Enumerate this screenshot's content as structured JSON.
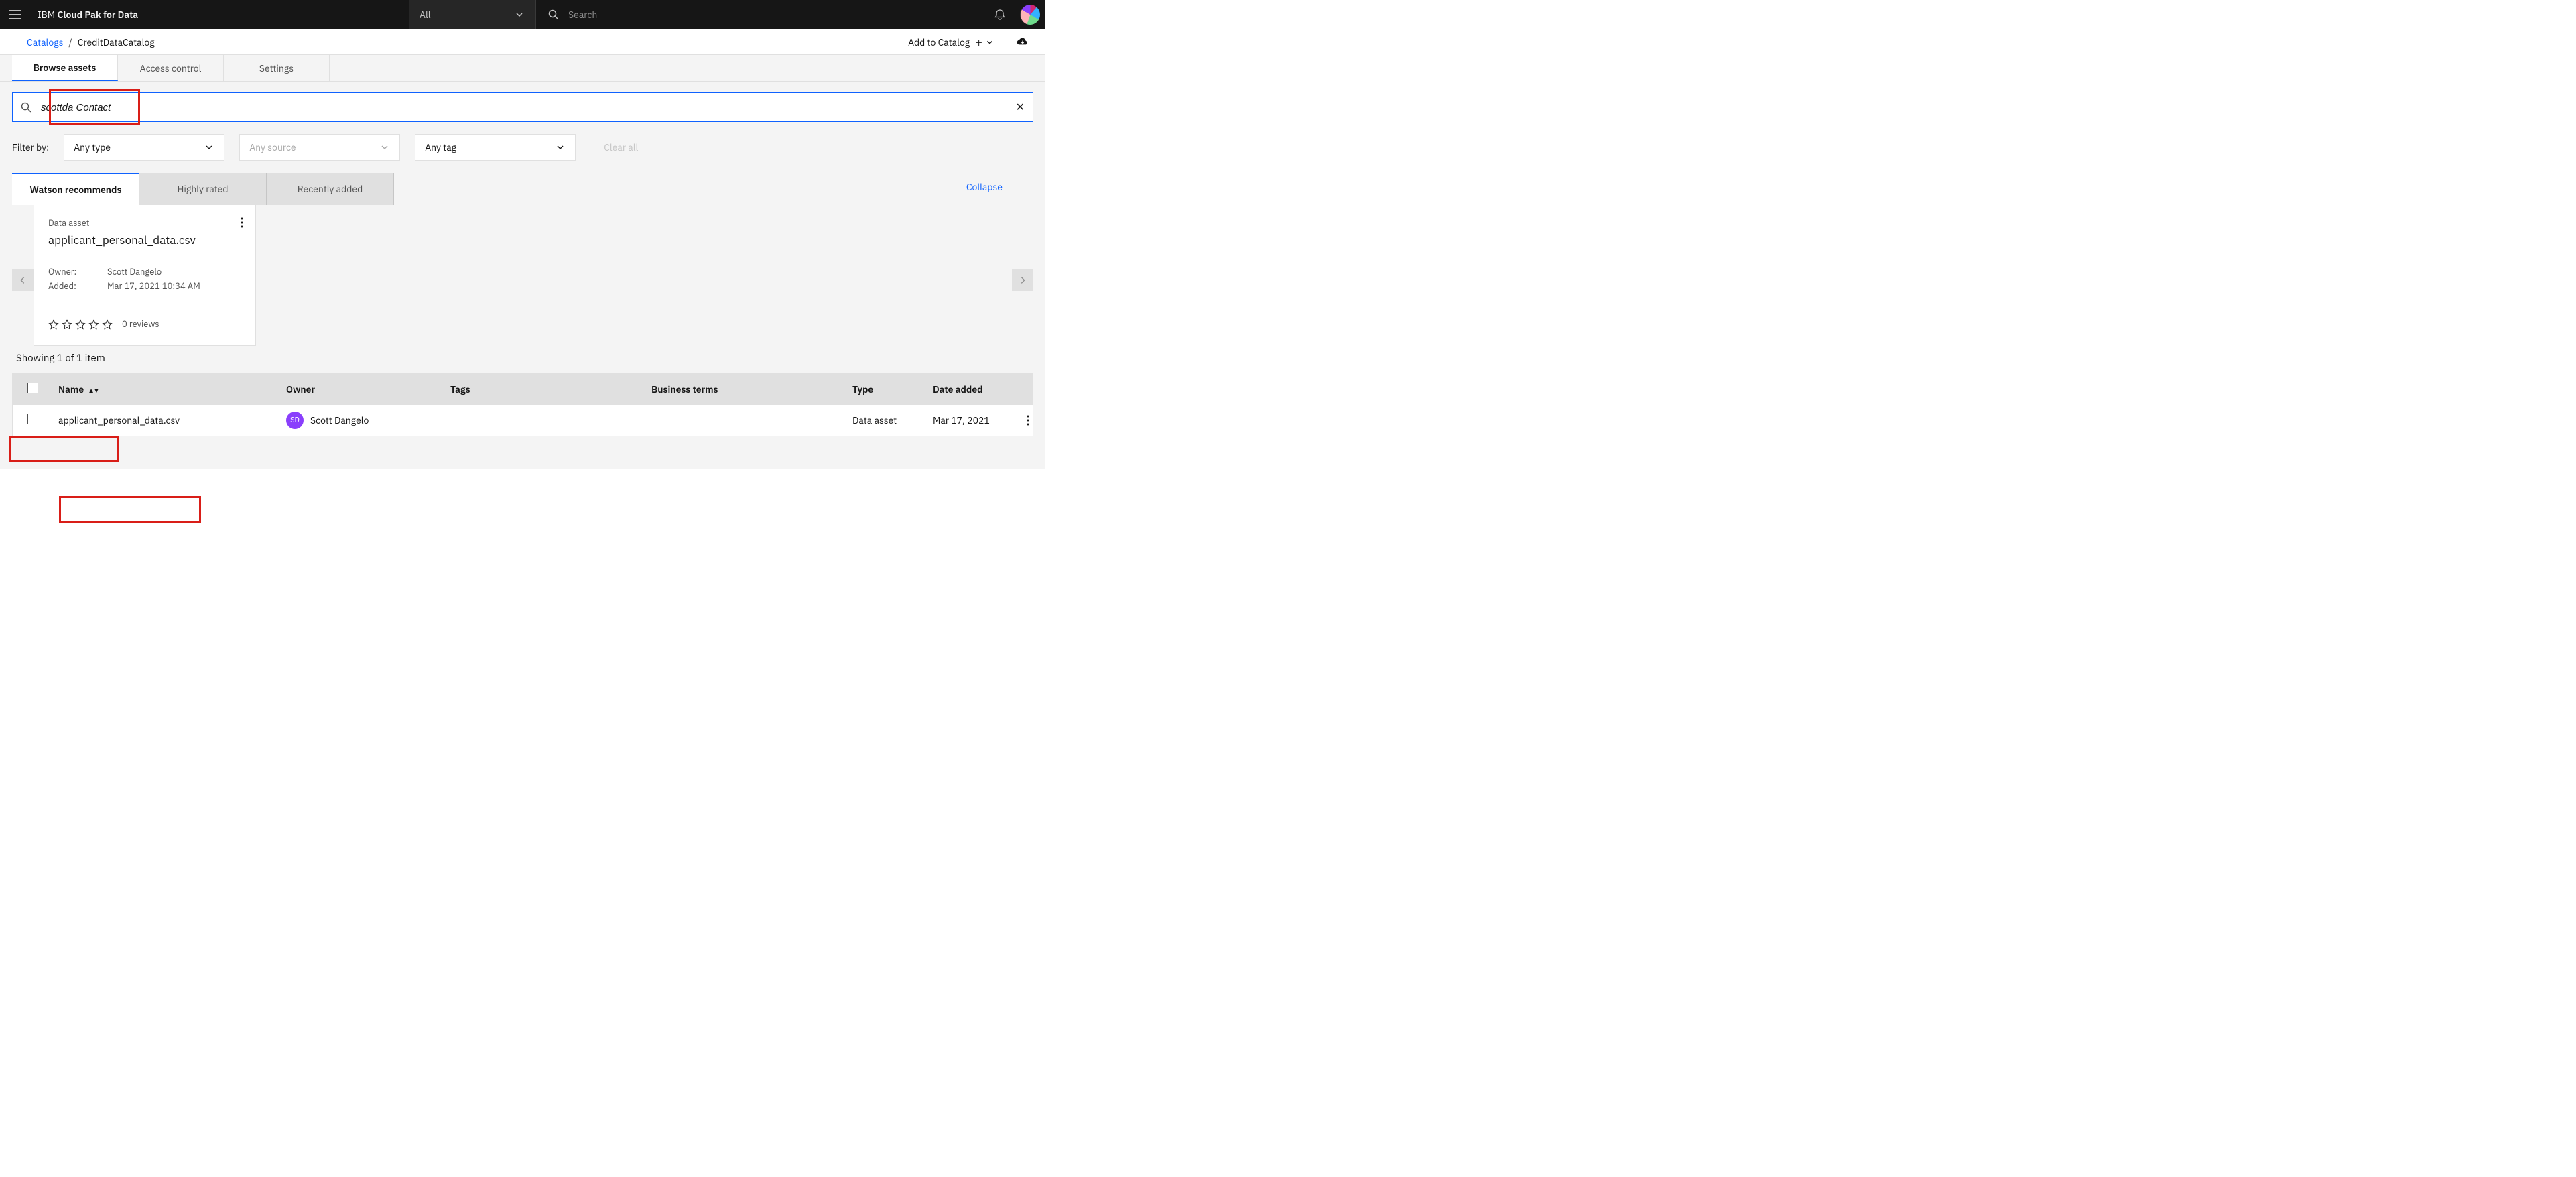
{
  "header": {
    "brand_prefix": "IBM",
    "brand_name": "Cloud Pak for Data",
    "scope_label": "All",
    "search_placeholder": "Search"
  },
  "breadcrumb": {
    "root": "Catalogs",
    "current": "CreditDataCatalog",
    "add_label": "Add to Catalog"
  },
  "page_tabs": [
    "Browse assets",
    "Access control",
    "Settings"
  ],
  "active_page_tab": 0,
  "search": {
    "value": "scottda Contact"
  },
  "filters": {
    "label": "Filter by:",
    "type": "Any type",
    "source": "Any source",
    "tag": "Any tag",
    "clear": "Clear all"
  },
  "rec_tabs": [
    "Watson recommends",
    "Highly rated",
    "Recently added"
  ],
  "rec_active": 0,
  "collapse_label": "Collapse",
  "card": {
    "type": "Data asset",
    "title": "applicant_personal_data.csv",
    "owner_label": "Owner:",
    "owner": "Scott Dangelo",
    "added_label": "Added:",
    "added": "Mar 17, 2021 10:34 AM",
    "reviews": "0 reviews"
  },
  "showing": "Showing 1 of 1 item",
  "table": {
    "headers": {
      "name": "Name",
      "owner": "Owner",
      "tags": "Tags",
      "terms": "Business terms",
      "type": "Type",
      "date": "Date added"
    },
    "rows": [
      {
        "name": "applicant_personal_data.csv",
        "owner": "Scott Dangelo",
        "owner_initials": "SD",
        "tags": "",
        "terms": "",
        "type": "Data asset",
        "date": "Mar 17, 2021"
      }
    ]
  }
}
